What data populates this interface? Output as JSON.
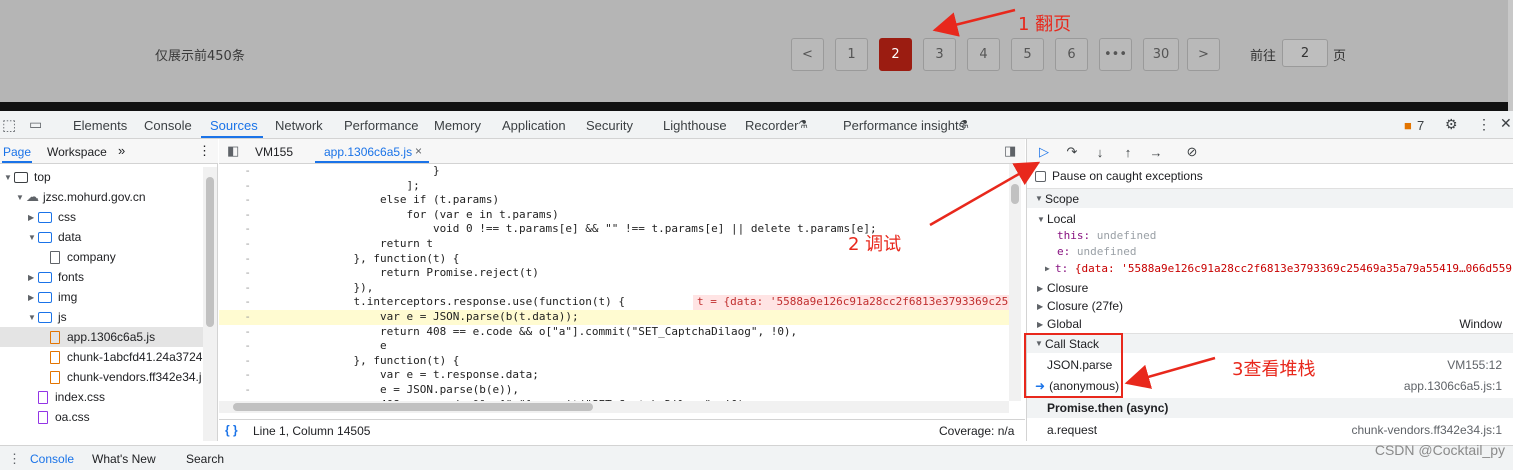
{
  "page": {
    "note": "仅展示前450条",
    "pagination": {
      "prev": "<",
      "pages": [
        "1",
        "2",
        "3",
        "4",
        "5",
        "6",
        "•••",
        "30"
      ],
      "active_page": "2",
      "next": ">",
      "goto_label": "前往",
      "goto_value": "2",
      "goto_suffix": "页"
    }
  },
  "devtools": {
    "tabs": [
      "Elements",
      "Console",
      "Sources",
      "Network",
      "Performance",
      "Memory",
      "Application",
      "Security",
      "Lighthouse",
      "Recorder",
      "Performance insights"
    ],
    "active_tab": "Sources",
    "issues_count": "7",
    "navigator": {
      "tabs": [
        "Page",
        "Workspace"
      ],
      "more": "»",
      "tree": [
        {
          "label": "top",
          "type": "frame",
          "depth": 0,
          "open": true
        },
        {
          "label": "jzsc.mohurd.gov.cn",
          "type": "cloud",
          "depth": 1,
          "open": true
        },
        {
          "label": "css",
          "type": "folder",
          "depth": 2,
          "open": false
        },
        {
          "label": "data",
          "type": "folder",
          "depth": 2,
          "open": true
        },
        {
          "label": "company",
          "type": "file",
          "depth": 3
        },
        {
          "label": "fonts",
          "type": "folder",
          "depth": 2,
          "open": false
        },
        {
          "label": "img",
          "type": "folder",
          "depth": 2,
          "open": false
        },
        {
          "label": "js",
          "type": "folder",
          "depth": 2,
          "open": true
        },
        {
          "label": "app.1306c6a5.js",
          "type": "js",
          "depth": 3,
          "selected": true
        },
        {
          "label": "chunk-1abcfd41.24a3724",
          "type": "js",
          "depth": 3
        },
        {
          "label": "chunk-vendors.ff342e34.j",
          "type": "js",
          "depth": 3
        },
        {
          "label": "index.css",
          "type": "css",
          "depth": 2
        },
        {
          "label": "oa.css",
          "type": "css",
          "depth": 2
        }
      ]
    },
    "editor": {
      "tabs": [
        "VM155",
        "app.1306c6a5.js"
      ],
      "active_tab": "app.1306c6a5.js",
      "close_glyph": "×",
      "lines": [
        {
          "g": "-",
          "t": "                        }"
        },
        {
          "g": "-",
          "t": "                    ];"
        },
        {
          "g": "-",
          "t": "                else if (t.params)"
        },
        {
          "g": "-",
          "t": "                    for (var e in t.params)"
        },
        {
          "g": "-",
          "t": "                        void 0 !== t.params[e] && \"\" !== t.params[e] || delete t.params[e];"
        },
        {
          "g": "-",
          "t": "                return t"
        },
        {
          "g": "-",
          "t": "            }, function(t) {"
        },
        {
          "g": "-",
          "t": "                return Promise.reject(t)"
        },
        {
          "g": "-",
          "t": "            }),"
        },
        {
          "g": "-",
          "t": "            t.interceptors.response.use(function(t) {",
          "inline": "t = {data: '5588a9e126c91a28cc2f6813e3793369c25"
        },
        {
          "g": "-",
          "t": "                var e = JSON.parse(b(t.data));",
          "highlight": true
        },
        {
          "g": "-",
          "t": "                return 408 == e.code && o[\"a\"].commit(\"SET_CaptchaDilaog\", !0),"
        },
        {
          "g": "-",
          "t": "                e"
        },
        {
          "g": "-",
          "t": "            }, function(t) {"
        },
        {
          "g": "-",
          "t": "                var e = t.response.data;"
        },
        {
          "g": "-",
          "t": "                e = JSON.parse(b(e)),"
        },
        {
          "g": "-",
          "t": "                408 == e.code && o[\"a\"].commit(\"SET_CaptchaDilaog\", !0)"
        }
      ],
      "status": "Line 1, Column 14505",
      "coverage": "Coverage: n/a"
    },
    "debugger": {
      "pause_on_caught": "Pause on caught exceptions",
      "scope_label": "Scope",
      "local_label": "Local",
      "local_vars": [
        {
          "name": "this:",
          "value": "undefined"
        },
        {
          "name": "e:",
          "value": "undefined"
        }
      ],
      "t_var": {
        "name": "t:",
        "value": "{data: '5588a9e126c91a28cc2f6813e3793369c25469a35a79a55419…066d559"
      },
      "closure_label": "Closure",
      "closure2_label": "Closure (27fe)",
      "global_label": "Global",
      "global_value": "Window",
      "callstack_label": "Call Stack",
      "frames": [
        {
          "fn": "JSON.parse",
          "loc": "VM155:12"
        },
        {
          "fn": "(anonymous)",
          "loc": "app.1306c6a5.js:1"
        }
      ],
      "async_label": "Promise.then (async)",
      "frame_after": {
        "fn": "a.request",
        "loc": "chunk-vendors.ff342e34.js:1"
      }
    },
    "drawer_tabs": [
      "Console",
      "What's New",
      "Search"
    ],
    "drawer_active": "Console"
  },
  "annotations": {
    "a1": "1 翻页",
    "a2": "2 调试",
    "a3": "3查看堆栈"
  },
  "watermark": "CSDN @Cocktail_py",
  "colors": {
    "accent": "#1a73e8",
    "active_page": "#9b1c11",
    "annotation": "#e8281c"
  }
}
